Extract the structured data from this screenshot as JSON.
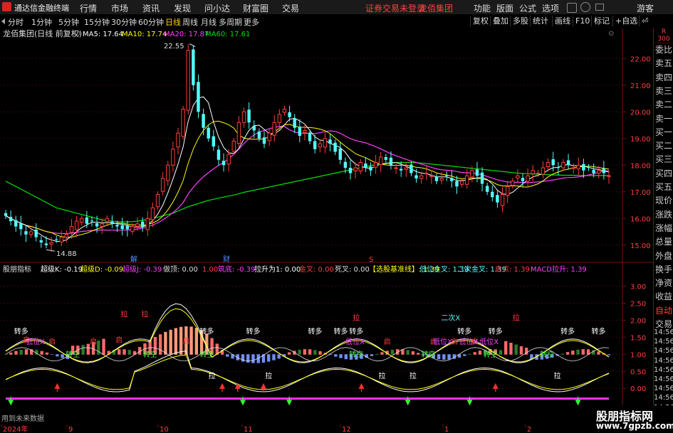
{
  "titlebar": {
    "app_title": "通达信金融终端",
    "menus": [
      "行情",
      "市场",
      "资讯",
      "发现",
      "问小达",
      "财富圈",
      "交易"
    ],
    "notice": "证券交易未登录",
    "stock_name_red": "龙佰集团",
    "right_menus": [
      "功能",
      "版面",
      "公式",
      "选项"
    ],
    "guest": "游客"
  },
  "toolbar": {
    "periods": [
      "分时",
      "1分钟",
      "5分钟",
      "15分钟",
      "30分钟",
      "60分钟",
      "日线",
      "周线",
      "月线",
      "多周期",
      "更多"
    ],
    "active_period": "日线",
    "right_buttons": [
      "复权",
      "叠加",
      "多股",
      "统计",
      "画线",
      "F10",
      "标记",
      "+自选",
      "⏎"
    ]
  },
  "main_chart": {
    "title": "龙佰集团(日线 前复权)",
    "ma": [
      {
        "label": "MA5: 17.64",
        "color": "#ffffff"
      },
      {
        "label": "MA10: 17.74",
        "color": "#ffff00"
      },
      {
        "label": "MA20: 17.87",
        "color": "#ff40ff"
      },
      {
        "label": "MA60: 17.61",
        "color": "#00e000"
      }
    ],
    "yticks": [
      "22.00",
      "21.00",
      "20.00",
      "19.00",
      "18.00",
      "17.00",
      "16.00",
      "15.00"
    ],
    "ytick_values": [
      22,
      21,
      20,
      19,
      18,
      17,
      16,
      15
    ],
    "high_label": "22.55",
    "low_label": "14.88",
    "marker_jie": "解",
    "marker_cai": "财",
    "marker_s": "S",
    "up_color": "#ff3c3c",
    "down_color": "#54ffff"
  },
  "chart_data": [
    {
      "type": "candlestick",
      "title": "龙佰集团(日线 前复权)",
      "y_range": [
        14.7,
        22.7
      ],
      "high": 22.55,
      "low": 14.88,
      "closes": [
        16.1,
        15.9,
        15.7,
        15.6,
        15.4,
        15.5,
        15.3,
        15.1,
        15.0,
        15.1,
        15.2,
        15.3,
        15.4,
        15.7,
        15.9,
        16.0,
        15.8,
        15.9,
        15.7,
        15.8,
        16.0,
        15.8,
        15.7,
        15.6,
        15.6,
        15.7,
        15.8,
        15.7,
        16.0,
        16.4,
        16.9,
        17.5,
        18.0,
        18.6,
        19.2,
        20.1,
        22.3,
        21.0,
        20.0,
        19.4,
        19.0,
        18.7,
        18.2,
        18.0,
        18.4,
        18.9,
        19.6,
        20.0,
        19.6,
        19.3,
        19.0,
        18.8,
        19.2,
        19.6,
        19.9,
        20.1,
        19.8,
        19.4,
        19.1,
        19.3,
        18.9,
        18.6,
        18.8,
        19.0,
        18.8,
        18.5,
        18.2,
        17.9,
        17.7,
        17.9,
        18.1,
        17.9,
        17.8,
        18.1,
        18.3,
        18.2,
        18.0,
        17.9,
        17.8,
        17.9,
        17.7,
        17.5,
        17.6,
        17.7,
        17.6,
        17.4,
        17.5,
        17.6,
        17.4,
        17.2,
        17.4,
        17.6,
        17.8,
        17.6,
        17.3,
        17.0,
        16.8,
        16.6,
        16.9,
        17.2,
        17.4,
        17.6,
        17.4,
        17.6,
        17.8,
        17.7,
        17.9,
        18.1,
        18.0,
        17.9,
        18.1,
        18.0,
        17.9,
        18.0,
        17.8,
        17.9,
        17.7,
        17.8,
        17.7,
        17.6
      ],
      "ma60": [
        17.4,
        17.3,
        17.2,
        17.1,
        17.0,
        16.9,
        16.8,
        16.7,
        16.6,
        16.5,
        16.4,
        16.35,
        16.3,
        16.25,
        16.2,
        16.15,
        16.1,
        16.05,
        16.0,
        15.95,
        15.92,
        15.9,
        15.88,
        15.87,
        15.87,
        15.88,
        15.9,
        15.93,
        15.96,
        16.0,
        16.05,
        16.1,
        16.15,
        16.2,
        16.28,
        16.36,
        16.44,
        16.5,
        16.56,
        16.62,
        16.68,
        16.72,
        16.76,
        16.8,
        16.84,
        16.88,
        16.93,
        16.98,
        17.02,
        17.06,
        17.1,
        17.14,
        17.18,
        17.22,
        17.26,
        17.3,
        17.34,
        17.38,
        17.42,
        17.46,
        17.5,
        17.54,
        17.58,
        17.62,
        17.66,
        17.7,
        17.74,
        17.78,
        17.82,
        17.86,
        17.9,
        17.94,
        17.98,
        18.02,
        18.05,
        18.07,
        18.09,
        18.1,
        18.1,
        18.1,
        18.1,
        18.09,
        18.08,
        18.06,
        18.04,
        18.02,
        18.0,
        17.98,
        17.96,
        17.94,
        17.92,
        17.9,
        17.88,
        17.86,
        17.84,
        17.82,
        17.8,
        17.78,
        17.76,
        17.74,
        17.72,
        17.7,
        17.69,
        17.68,
        17.67,
        17.66,
        17.65,
        17.64,
        17.63,
        17.63,
        17.62,
        17.62,
        17.62,
        17.61,
        17.61,
        17.61,
        17.61,
        17.61,
        17.61,
        17.61
      ]
    },
    {
      "type": "bar",
      "title": "股朋指标",
      "legend": [
        "超级K: -0.19",
        "超级D: -0.09",
        "超级J: -0.39",
        "做顶: 0.00",
        "1.00",
        "筑底: -0.39",
        "拉升为1: 0.00",
        "金叉: 0.00",
        "死叉: 0.00",
        "【选股基准线】: 1.39",
        "低位金叉: 1.39",
        "二次金叉: 1.39",
        "启点: 1.39",
        "MACD拉升: 1.39"
      ],
      "yticks": [
        "3.00",
        "2.50",
        "2.00",
        "1.50",
        "1.00",
        "0.50",
        "0.00"
      ],
      "ytick_values": [
        3.0,
        2.5,
        2.0,
        1.5,
        1.0,
        0.5,
        0.0
      ],
      "y_range": [
        -0.6,
        3.3
      ]
    }
  ],
  "indicator_labels": {
    "qi": "启",
    "la": "拉",
    "zhuanduo": "转多",
    "zhuankong": "转空",
    "diwei": "低位X",
    "erci": "二次X"
  },
  "x_axis": {
    "labels": [
      "2024年",
      "9",
      "10",
      "11",
      "12",
      "1",
      "2"
    ]
  },
  "sidebar": {
    "order_book": [
      "委比",
      "卖五",
      "卖四",
      "卖三",
      "卖二",
      "卖一",
      "买一",
      "买二",
      "买三",
      "买四",
      "买五",
      "现价",
      "涨跌",
      "涨幅",
      "总量",
      "外盘",
      "换手",
      "净资",
      "收益",
      "自动",
      "交易"
    ],
    "r_label": "R",
    "num_label": "300",
    "times": [
      "14:56",
      "14:56",
      "14:56",
      "14:56",
      "14:56",
      "14:56",
      "14:56",
      "14:56",
      "14:56",
      "14:56"
    ]
  },
  "footer": {
    "notice": "用到未来数据"
  },
  "watermark": {
    "title": "股朋指标网",
    "url": "www.7gpzb.com"
  }
}
